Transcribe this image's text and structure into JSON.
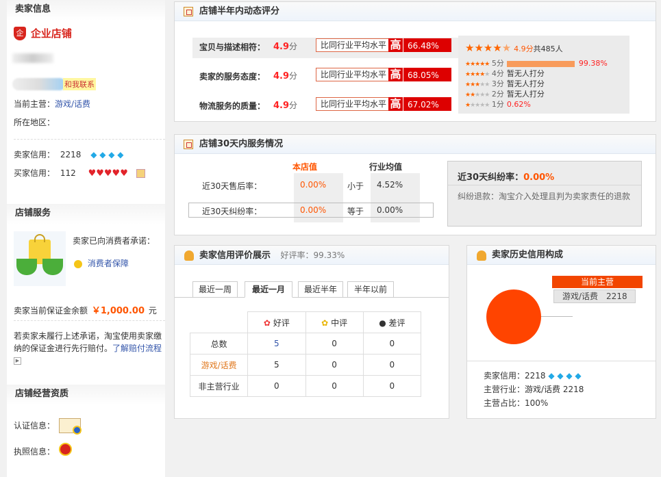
{
  "left": {
    "seller_info_title": "卖家信息",
    "shop_type": "企业店铺",
    "contact_label": "和我联系",
    "main_business_label": "当前主营：",
    "main_business_value": "游戏/话费",
    "location_label": "所在地区：",
    "seller_credit_label": "卖家信用：",
    "seller_credit_value": "2218",
    "buyer_credit_label": "买家信用：",
    "buyer_credit_value": "112",
    "shop_service_title": "店铺服务",
    "promise_text": "卖家已向消费者承诺：",
    "consumer_protect": "消费者保障",
    "deposit_label": "卖家当前保证金余额",
    "deposit_value": "￥1,000.00",
    "deposit_unit": "元",
    "compensation_text": "若卖家未履行上述承诺，淘宝使用卖家缴纳的保证金进行先行赔付。",
    "compensation_link": "了解赔付流程",
    "qualification_title": "店铺经营资质",
    "cert_label": "认证信息：",
    "license_label": "执照信息："
  },
  "dsr": {
    "title": "店铺半年内动态评分",
    "rows": [
      {
        "label": "宝贝与描述相符：",
        "score": "4.9",
        "unit": "分",
        "compare": "比同行业平均水平",
        "level": "高",
        "percent": "66.48%"
      },
      {
        "label": "卖家的服务态度：",
        "score": "4.9",
        "unit": "分",
        "compare": "比同行业平均水平",
        "level": "高",
        "percent": "68.05%"
      },
      {
        "label": "物流服务的质量：",
        "score": "4.9",
        "unit": "分",
        "compare": "比同行业平均水平",
        "level": "高",
        "percent": "67.02%"
      }
    ],
    "summary_score": "4.9分",
    "summary_total": "共485人",
    "summary_rating": 4.9,
    "distribution": [
      {
        "label": "5分",
        "text": "99.38%",
        "fraction": 0.9938
      },
      {
        "label": "4分",
        "text": "暂无人打分",
        "fraction": 0
      },
      {
        "label": "3分",
        "text": "暂无人打分",
        "fraction": 0
      },
      {
        "label": "2分",
        "text": "暂无人打分",
        "fraction": 0
      },
      {
        "label": "1分",
        "text": "0.62%",
        "fraction": 0.0062
      }
    ]
  },
  "service30": {
    "title": "店铺30天内服务情况",
    "col_shop": "本店值",
    "col_industry": "行业均值",
    "rows": [
      {
        "label": "近30天售后率：",
        "shop": "0.00%",
        "relation": "小于",
        "industry": "4.52%"
      },
      {
        "label": "近30天纠纷率：",
        "shop": "0.00%",
        "relation": "等于",
        "industry": "0.00%"
      }
    ],
    "dispute_title": "近30天纠纷率：",
    "dispute_value": "0.00%",
    "dispute_desc": "纠纷退款：淘宝介入处理且判为卖家责任的退款"
  },
  "rating": {
    "title": "卖家信用评价展示",
    "good_rate": "好评率：99.33%",
    "tabs": [
      "最近一周",
      "最近一月",
      "最近半年",
      "半年以前"
    ],
    "active_tab": 1,
    "headers": [
      "好评",
      "中评",
      "差评"
    ],
    "rows": [
      {
        "label": "总数",
        "values": [
          "5",
          "0",
          "0"
        ]
      },
      {
        "label": "游戏/话费",
        "values": [
          "5",
          "0",
          "0"
        ]
      },
      {
        "label": "非主营行业",
        "values": [
          "0",
          "0",
          "0"
        ]
      }
    ]
  },
  "history": {
    "title": "卖家历史信用构成",
    "current_main": "当前主营",
    "category": "游戏/话费",
    "category_value": "2218",
    "credit_label": "卖家信用：",
    "credit_value": "2218",
    "main_industry_label": "主营行业：",
    "main_industry_value": "游戏/话费 2218",
    "main_ratio_label": "主营占比：",
    "main_ratio_value": "100%",
    "pie_fraction": 1.0,
    "pie_color": "#ff4400"
  }
}
